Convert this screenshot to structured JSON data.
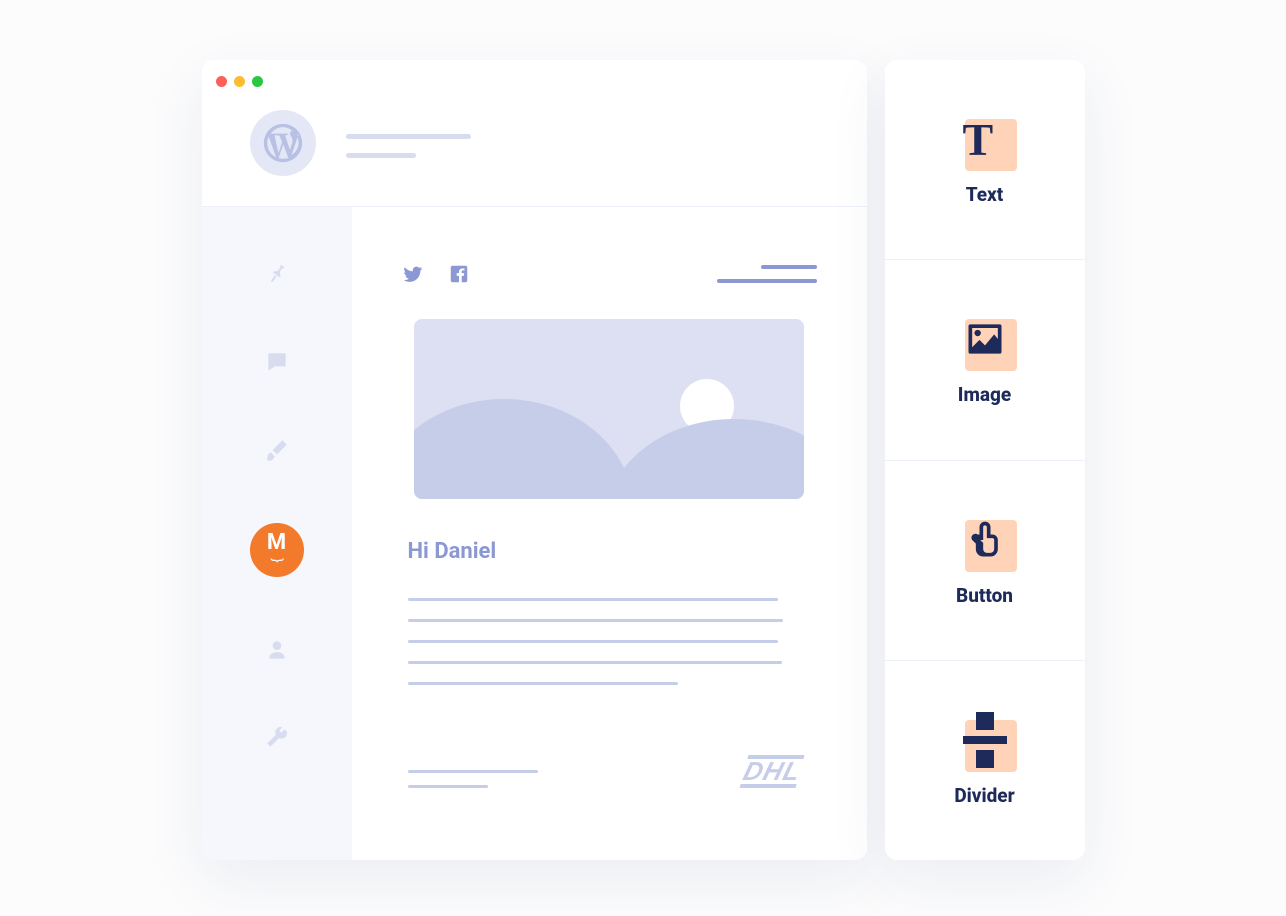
{
  "window": {
    "platform_icon": "wordpress-icon"
  },
  "sidebar": {
    "items": [
      {
        "icon": "pin-icon"
      },
      {
        "icon": "comment-icon"
      },
      {
        "icon": "brush-icon"
      },
      {
        "icon": "mailpoet-logo",
        "active": true,
        "letter": "M"
      },
      {
        "icon": "user-icon"
      },
      {
        "icon": "wrench-icon"
      }
    ]
  },
  "editor": {
    "social": [
      "twitter-icon",
      "facebook-icon"
    ],
    "greeting": "Hi Daniel",
    "footer_brand": "DHL"
  },
  "panel": {
    "blocks": [
      {
        "icon": "text-block-icon",
        "label": "Text"
      },
      {
        "icon": "image-block-icon",
        "label": "Image"
      },
      {
        "icon": "button-block-icon",
        "label": "Button"
      },
      {
        "icon": "divider-block-icon",
        "label": "Divider"
      }
    ]
  }
}
